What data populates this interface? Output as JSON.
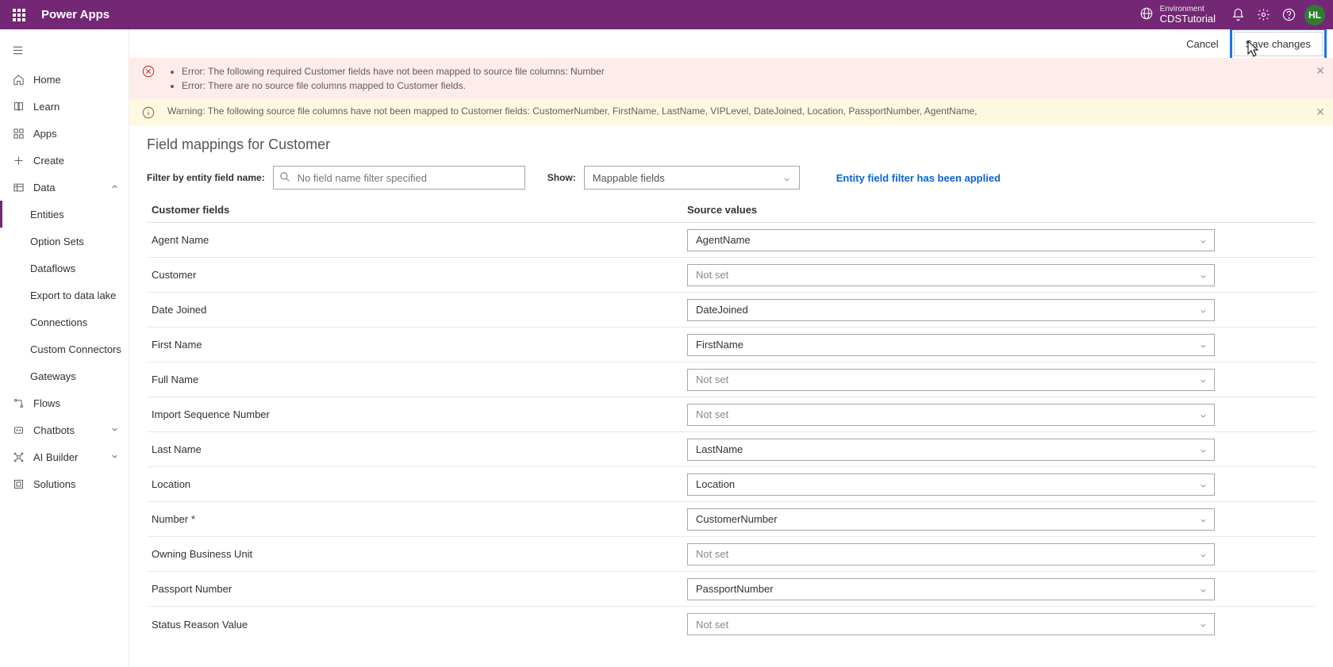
{
  "header": {
    "app_title": "Power Apps",
    "env_label": "Environment",
    "env_name": "CDSTutorial",
    "avatar": "HL"
  },
  "cmdbar": {
    "cancel": "Cancel",
    "save": "Save changes"
  },
  "sidebar": {
    "home": "Home",
    "learn": "Learn",
    "apps": "Apps",
    "create": "Create",
    "data": "Data",
    "entities": "Entities",
    "option_sets": "Option Sets",
    "dataflows": "Dataflows",
    "export": "Export to data lake",
    "connections": "Connections",
    "custom_conn": "Custom Connectors",
    "gateways": "Gateways",
    "flows": "Flows",
    "chatbots": "Chatbots",
    "ai_builder": "AI Builder",
    "solutions": "Solutions"
  },
  "banners": {
    "error1": "Error: The following required Customer fields have not been mapped to source file columns: Number",
    "error2": "Error: There are no source file columns mapped to Customer fields.",
    "warning": "Warning: The following source file columns have not been mapped to Customer fields: CustomerNumber, FirstName, LastName, VIPLevel, DateJoined, Location, PassportNumber, AgentName,"
  },
  "page": {
    "title": "Field mappings for Customer",
    "filter_label": "Filter by entity field name:",
    "filter_placeholder": "No field name filter specified",
    "show_label": "Show:",
    "show_value": "Mappable fields",
    "filter_msg": "Entity field filter has been applied",
    "col_cust": "Customer fields",
    "col_src": "Source values"
  },
  "mappings": [
    {
      "label": "Agent Name",
      "value": "AgentName",
      "set": true
    },
    {
      "label": "Customer",
      "value": "Not set",
      "set": false
    },
    {
      "label": "Date Joined",
      "value": "DateJoined",
      "set": true
    },
    {
      "label": "First Name",
      "value": "FirstName",
      "set": true
    },
    {
      "label": "Full Name",
      "value": "Not set",
      "set": false
    },
    {
      "label": "Import Sequence Number",
      "value": "Not set",
      "set": false
    },
    {
      "label": "Last Name",
      "value": "LastName",
      "set": true
    },
    {
      "label": "Location",
      "value": "Location",
      "set": true
    },
    {
      "label": "Number *",
      "value": "CustomerNumber",
      "set": true
    },
    {
      "label": "Owning Business Unit",
      "value": "Not set",
      "set": false
    },
    {
      "label": "Passport Number",
      "value": "PassportNumber",
      "set": true
    },
    {
      "label": "Status Reason Value",
      "value": "Not set",
      "set": false
    }
  ]
}
